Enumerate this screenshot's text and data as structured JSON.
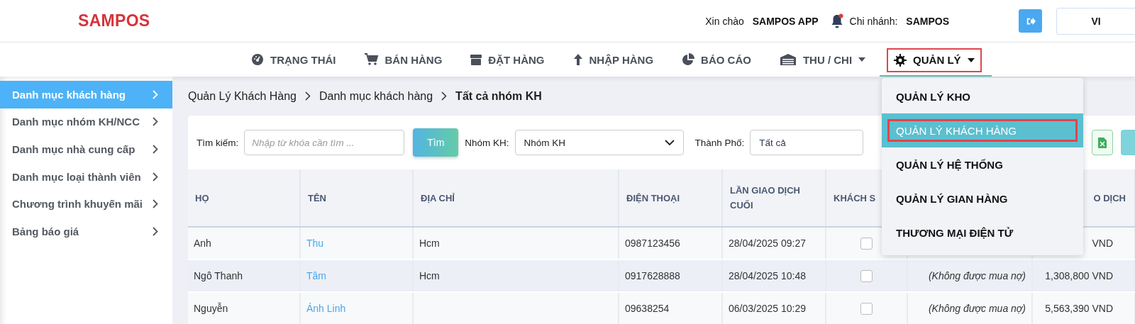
{
  "header": {
    "logo": "SAMPOS",
    "greeting": "Xin chào",
    "user": "SAMPOS APP",
    "notification": true,
    "branch_label": "Chi nhánh:",
    "branch": "SAMPOS",
    "language": "VI"
  },
  "nav": [
    {
      "label": "TRẠNG THÁI",
      "selected": false,
      "caret": false
    },
    {
      "label": "BÁN HÀNG",
      "selected": false,
      "caret": false
    },
    {
      "label": "ĐẶT HÀNG",
      "selected": false,
      "caret": false
    },
    {
      "label": "NHẬP HÀNG",
      "selected": false,
      "caret": false
    },
    {
      "label": "BÁO CÁO",
      "selected": false,
      "caret": false
    },
    {
      "label": "THU / CHI",
      "selected": false,
      "caret": true
    },
    {
      "label": "QUẢN LÝ",
      "selected": true,
      "caret": true
    }
  ],
  "dropdown": [
    {
      "label": "QUẢN LÝ KHO",
      "selected": false
    },
    {
      "label": "QUẢN LÝ KHÁCH HÀNG",
      "selected": true
    },
    {
      "label": "QUẢN LÝ HỆ THỐNG",
      "selected": false
    },
    {
      "label": "QUẢN LÝ GIAN HÀNG",
      "selected": false
    },
    {
      "label": "THƯƠNG MẠI ĐIỆN TỬ",
      "selected": false
    }
  ],
  "sidebar": {
    "items": [
      {
        "label": "Danh mục khách hàng",
        "selected": true
      },
      {
        "label": "Danh mục nhóm KH/NCC",
        "selected": false
      },
      {
        "label": "Danh mục nhà cung cấp",
        "selected": false
      },
      {
        "label": "Danh mục loại thành viên",
        "selected": false
      },
      {
        "label": "Chương trình khuyến mãi",
        "selected": false
      },
      {
        "label": "Bảng báo giá",
        "selected": false
      }
    ]
  },
  "breadcrumb": [
    "Quản Lý Khách Hàng",
    "Danh mục khách hàng",
    "Tất cả nhóm KH"
  ],
  "filters": {
    "search_label": "Tìm kiếm:",
    "search_placeholder": "Nhập từ khóa cần tìm ...",
    "search_button": "Tìm",
    "group_label": "Nhóm KH:",
    "group_value": "Nhóm KH",
    "city_label": "Thành Phố:",
    "city_value": "Tất cả"
  },
  "table": {
    "columns": [
      "HỌ",
      "TÊN",
      "ĐỊA CHỈ",
      "ĐIỆN THOẠI",
      "LẦN GIAO DỊCH CUỐI",
      "KHÁCH S",
      "O DỊCH"
    ],
    "rows": [
      {
        "last_name": "Anh",
        "first_name": "Thu",
        "address": "Hcm",
        "phone": "0987123456",
        "last_transaction": "28/04/2025 09:27",
        "wholesale": false,
        "amount": "VND"
      },
      {
        "last_name": "Ngô Thanh",
        "first_name": "Tâm",
        "address": "Hcm",
        "phone": "0917628888",
        "last_transaction": "28/04/2025 10:48",
        "wholesale": false,
        "credit": "(Không được mua nợ)",
        "amount": "1,308,800 VND"
      },
      {
        "last_name": "Nguyễn",
        "first_name": "Ánh Linh",
        "phone": "09638254",
        "last_transaction": "06/03/2025 10:29",
        "wholesale": false,
        "credit": "(Không được mua nợ)",
        "amount": "5,563,390 VND"
      }
    ]
  }
}
